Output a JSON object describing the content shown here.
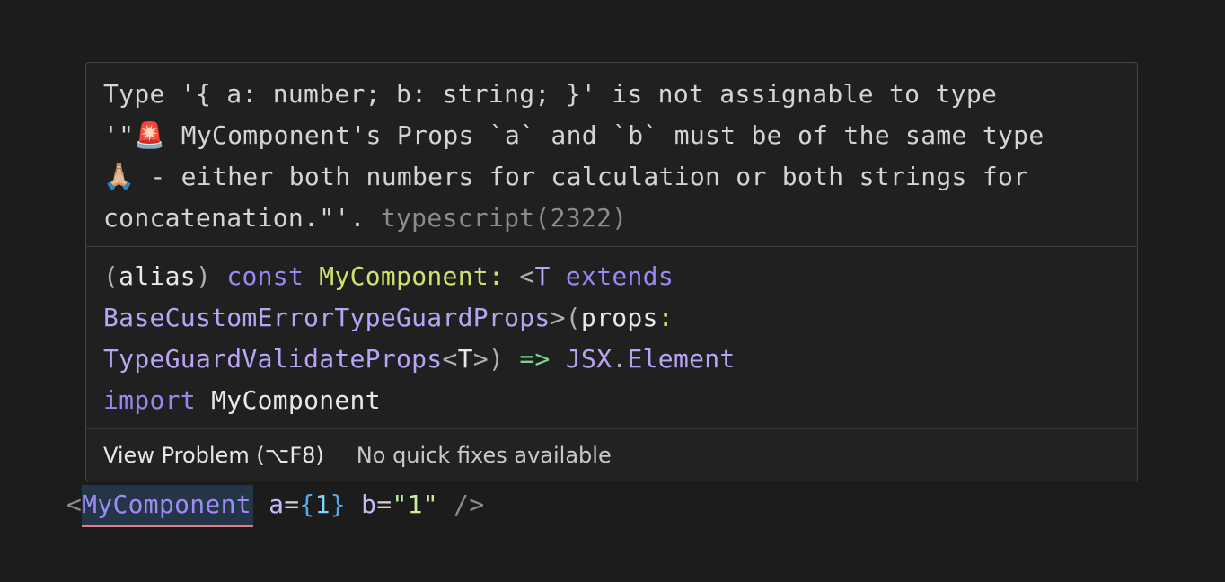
{
  "hover": {
    "diagnostic": {
      "line1": "Type '{ a: number; b: string; }' is not assignable to type",
      "line2_prefix": "'\"",
      "line2_emoji": "🚨",
      "line2_text": " MyComponent's Props `a` and `b` must be of the same type",
      "line3_emoji": "🙏🏼",
      "line3_text": " - either both numbers for calculation or both strings for",
      "line4_text": "concatenation.\"'. ",
      "source": "typescript(2322)"
    },
    "signature": {
      "alias_open": "(",
      "alias": "alias",
      "alias_close": ")",
      "const_kw": "const",
      "component_name": "MyComponent",
      "colon": ":",
      "lt": "<",
      "T": "T",
      "extends_kw": "extends",
      "base_props": "BaseCustomErrorTypeGuardProps",
      "gt_paren": ">(",
      "props": "props",
      "colon2": ":",
      "validate_props": "TypeGuardValidateProps",
      "lt2": "<",
      "T2": "T",
      "gt2": ">",
      "close_paren": ")",
      "arrow": "=>",
      "jsx": "JSX",
      "dot": ".",
      "element": "Element",
      "import_kw": "import",
      "import_name": "MyComponent"
    },
    "actions": {
      "view_problem": "View Problem (⌥F8)",
      "no_fixes": "No quick fixes available"
    }
  },
  "code": {
    "open": "<",
    "component": "MyComponent",
    "attr_a": "a",
    "eq1": "=",
    "brace_open": "{",
    "a_value": "1",
    "brace_close": "}",
    "attr_b": "b",
    "eq2": "=",
    "b_value": "\"1\"",
    "close": "/>"
  }
}
